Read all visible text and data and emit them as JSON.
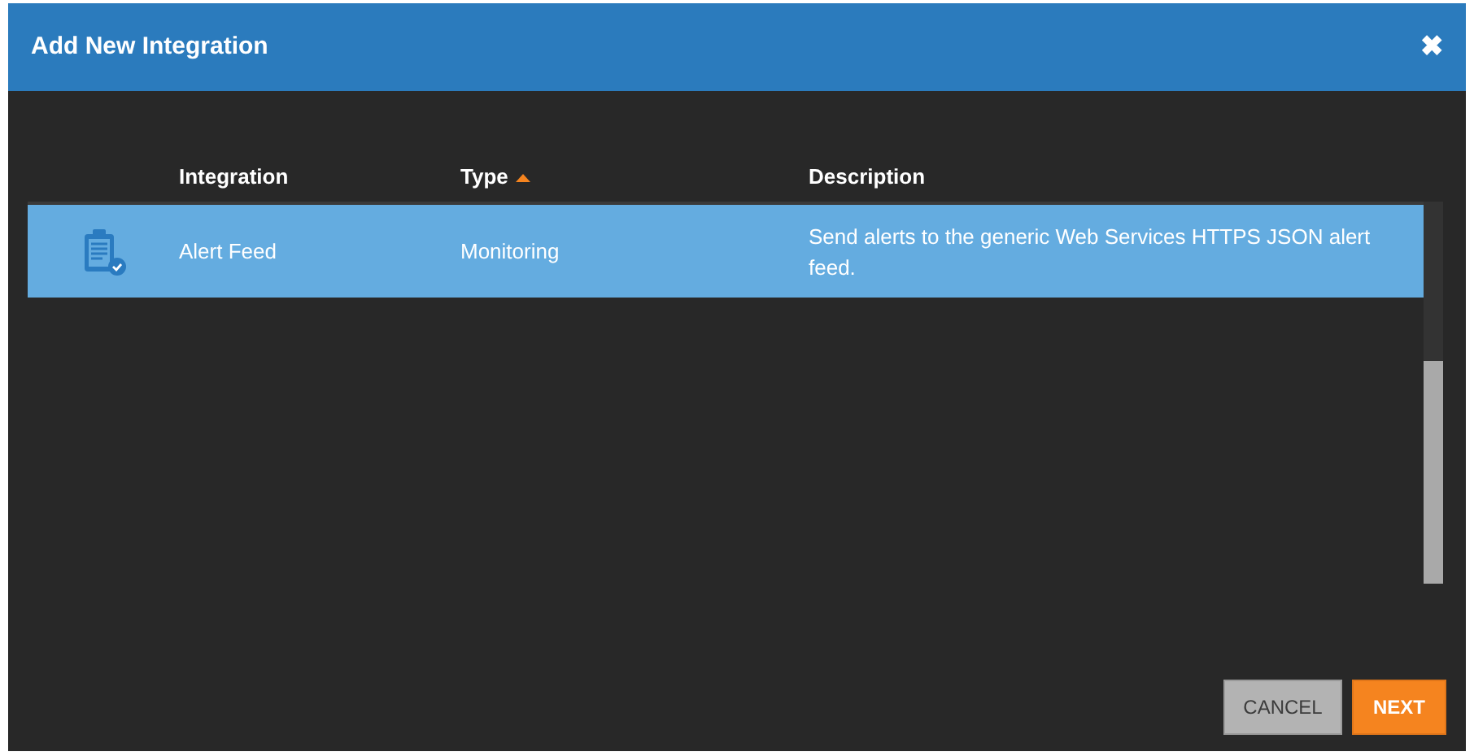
{
  "dialog": {
    "title": "Add New Integration",
    "close": "✖"
  },
  "table": {
    "columns": [
      {
        "label": "Integration",
        "sorted": false
      },
      {
        "label": "Type",
        "sorted": true
      },
      {
        "label": "Description",
        "sorted": false
      }
    ],
    "rows": [
      {
        "integration": "Alert Feed",
        "type": "Monitoring",
        "description": "Send alerts to the generic Web Services HTTPS JSON alert feed.",
        "selected": true
      }
    ]
  },
  "buttons": [
    {
      "label": "CANCEL",
      "kind": "secondary"
    },
    {
      "label": "NEXT",
      "kind": "primary"
    }
  ]
}
